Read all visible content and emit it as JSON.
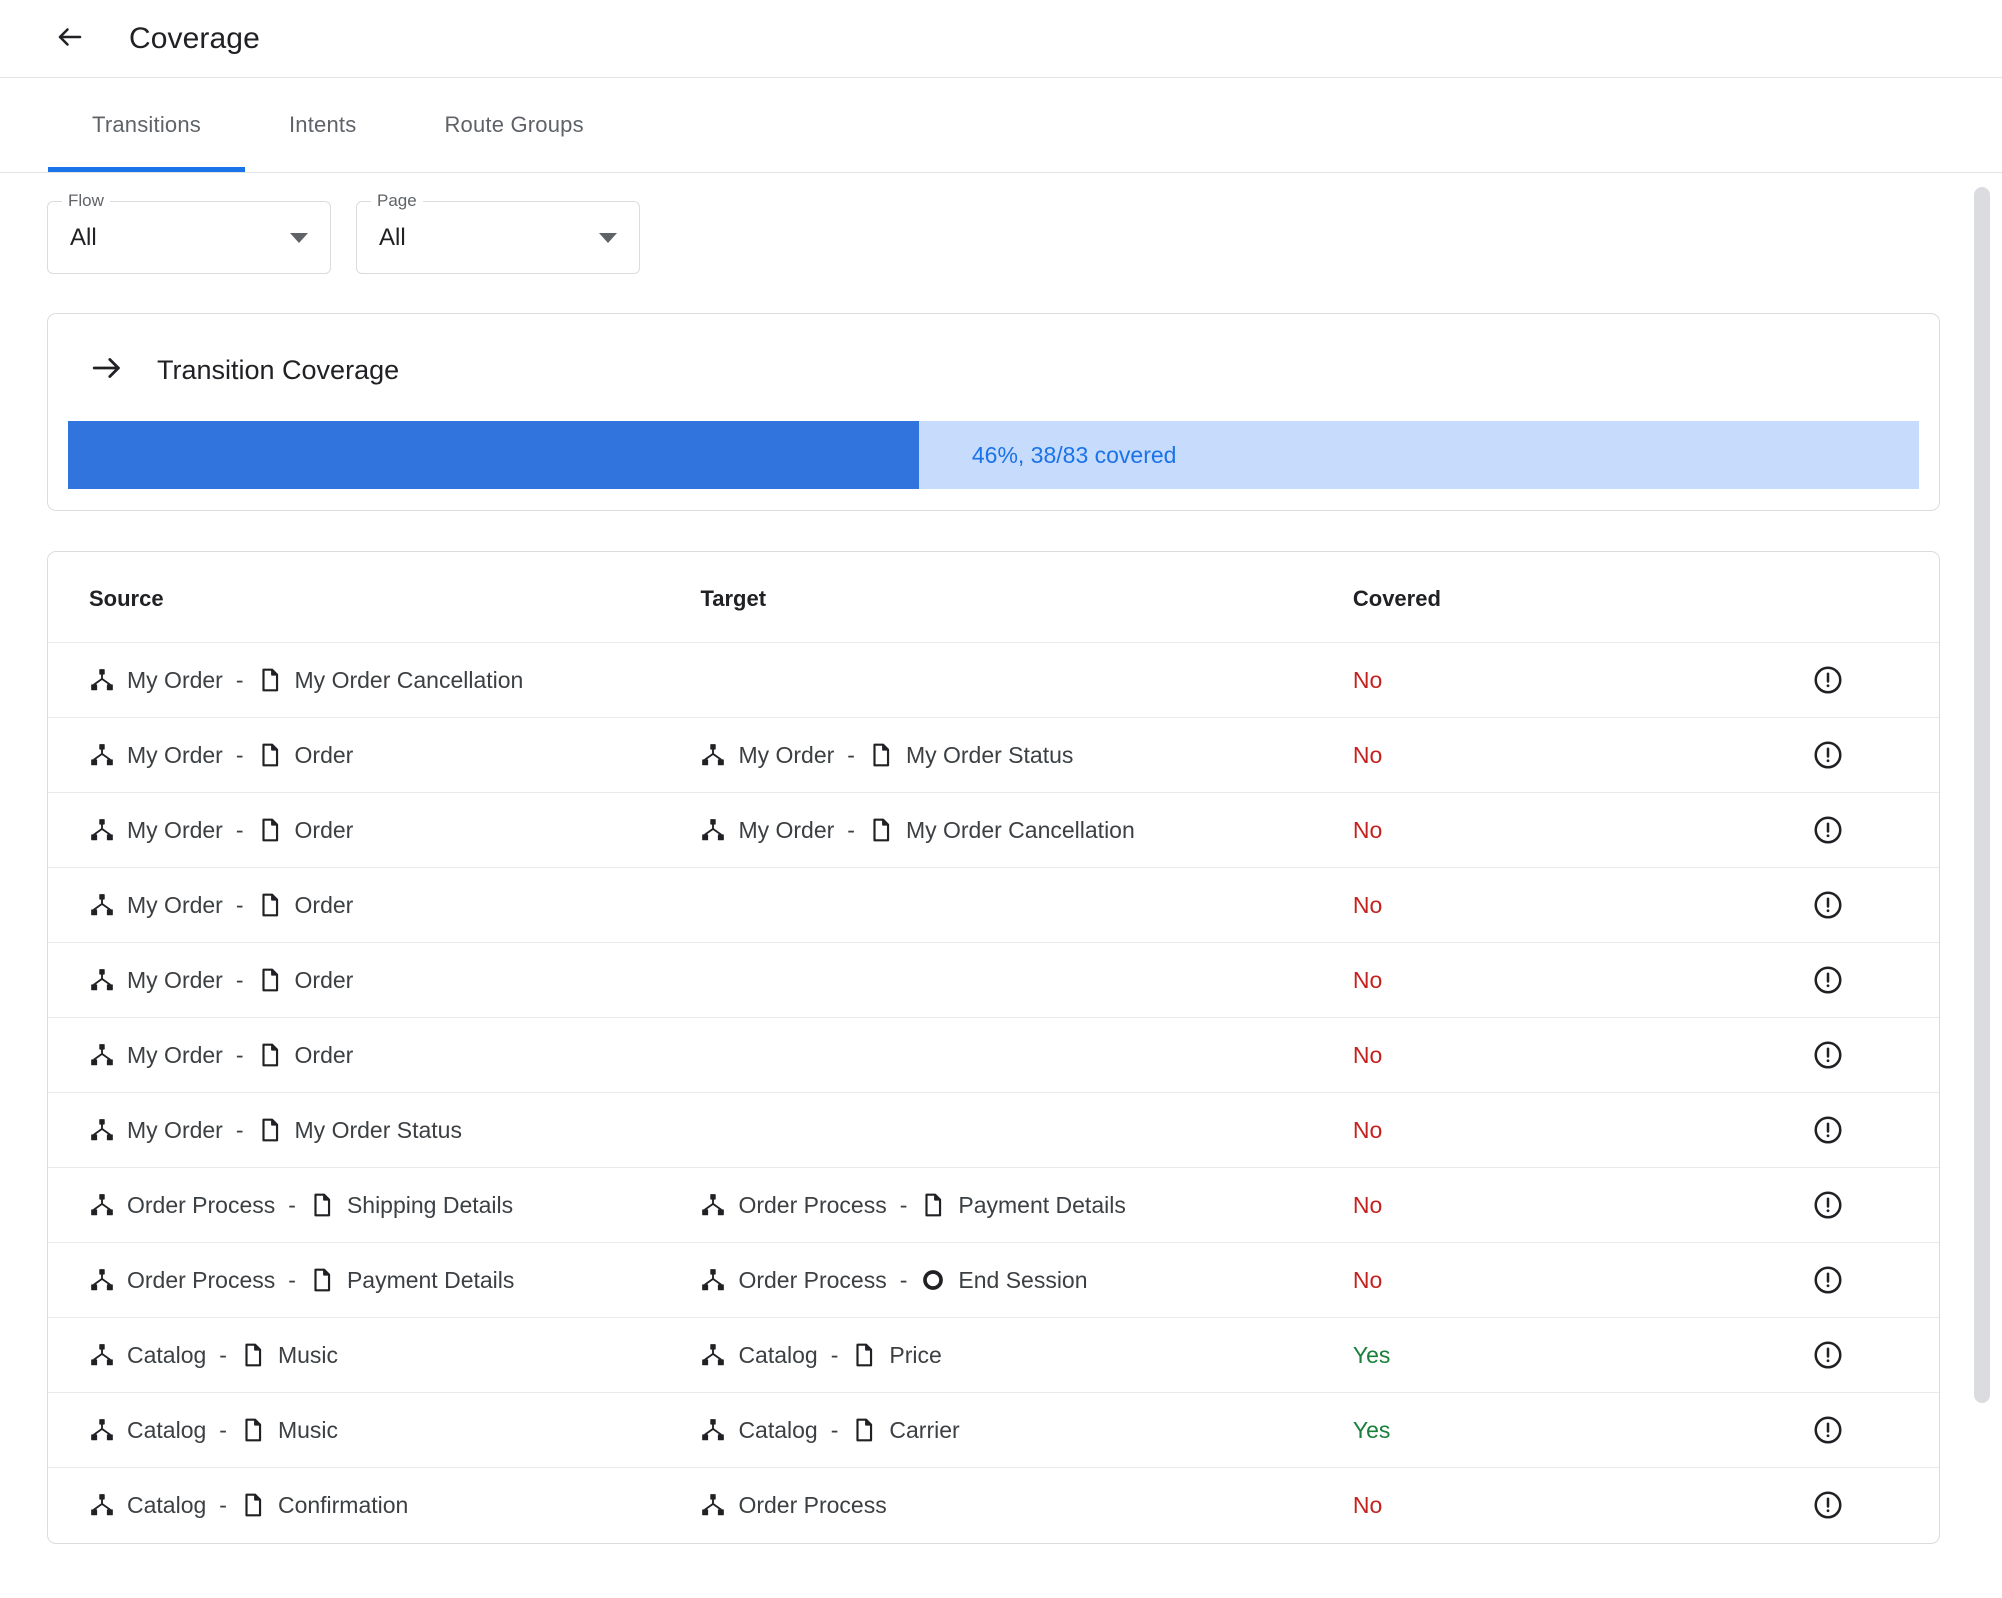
{
  "header": {
    "title": "Coverage",
    "back_icon": "arrow-left-icon"
  },
  "tabs": [
    {
      "label": "Transitions",
      "active": true
    },
    {
      "label": "Intents",
      "active": false
    },
    {
      "label": "Route Groups",
      "active": false
    }
  ],
  "filters": [
    {
      "label": "Flow",
      "value": "All",
      "name": "flow-select"
    },
    {
      "label": "Page",
      "value": "All",
      "name": "page-select"
    }
  ],
  "coverage_card": {
    "icon": "arrow-right-icon",
    "title": "Transition Coverage",
    "progress_text": "46%, 38/83 covered",
    "percent": 46,
    "covered": 38,
    "total": 83,
    "fill_color": "#3274dd",
    "track_color": "#c7dbfc",
    "text_color": "#1a73e8"
  },
  "table": {
    "columns": [
      "Source",
      "Target",
      "Covered"
    ],
    "covered_yes_color": "#188038",
    "covered_no_color": "#c5221f",
    "row_icon": "error-circle-icon",
    "rows": [
      {
        "source": {
          "flow": "My Order",
          "node": "My Order Cancellation",
          "node_type": "page"
        },
        "target": null,
        "covered": "No"
      },
      {
        "source": {
          "flow": "My Order",
          "node": "Order",
          "node_type": "page"
        },
        "target": {
          "flow": "My Order",
          "node": "My Order Status",
          "node_type": "page"
        },
        "covered": "No"
      },
      {
        "source": {
          "flow": "My Order",
          "node": "Order",
          "node_type": "page"
        },
        "target": {
          "flow": "My Order",
          "node": "My Order Cancellation",
          "node_type": "page"
        },
        "covered": "No"
      },
      {
        "source": {
          "flow": "My Order",
          "node": "Order",
          "node_type": "page"
        },
        "target": null,
        "covered": "No"
      },
      {
        "source": {
          "flow": "My Order",
          "node": "Order",
          "node_type": "page"
        },
        "target": null,
        "covered": "No"
      },
      {
        "source": {
          "flow": "My Order",
          "node": "Order",
          "node_type": "page"
        },
        "target": null,
        "covered": "No"
      },
      {
        "source": {
          "flow": "My Order",
          "node": "My Order Status",
          "node_type": "page"
        },
        "target": null,
        "covered": "No"
      },
      {
        "source": {
          "flow": "Order Process",
          "node": "Shipping Details",
          "node_type": "page"
        },
        "target": {
          "flow": "Order Process",
          "node": "Payment Details",
          "node_type": "page"
        },
        "covered": "No"
      },
      {
        "source": {
          "flow": "Order Process",
          "node": "Payment Details",
          "node_type": "page"
        },
        "target": {
          "flow": "Order Process",
          "node": "End Session",
          "node_type": "end-session"
        },
        "covered": "No"
      },
      {
        "source": {
          "flow": "Catalog",
          "node": "Music",
          "node_type": "page"
        },
        "target": {
          "flow": "Catalog",
          "node": "Price",
          "node_type": "page"
        },
        "covered": "Yes"
      },
      {
        "source": {
          "flow": "Catalog",
          "node": "Music",
          "node_type": "page"
        },
        "target": {
          "flow": "Catalog",
          "node": "Carrier",
          "node_type": "page"
        },
        "covered": "Yes"
      },
      {
        "source": {
          "flow": "Catalog",
          "node": "Confirmation",
          "node_type": "page"
        },
        "target": {
          "flow": "Order Process",
          "node": null,
          "node_type": null
        },
        "covered": "No"
      }
    ]
  }
}
